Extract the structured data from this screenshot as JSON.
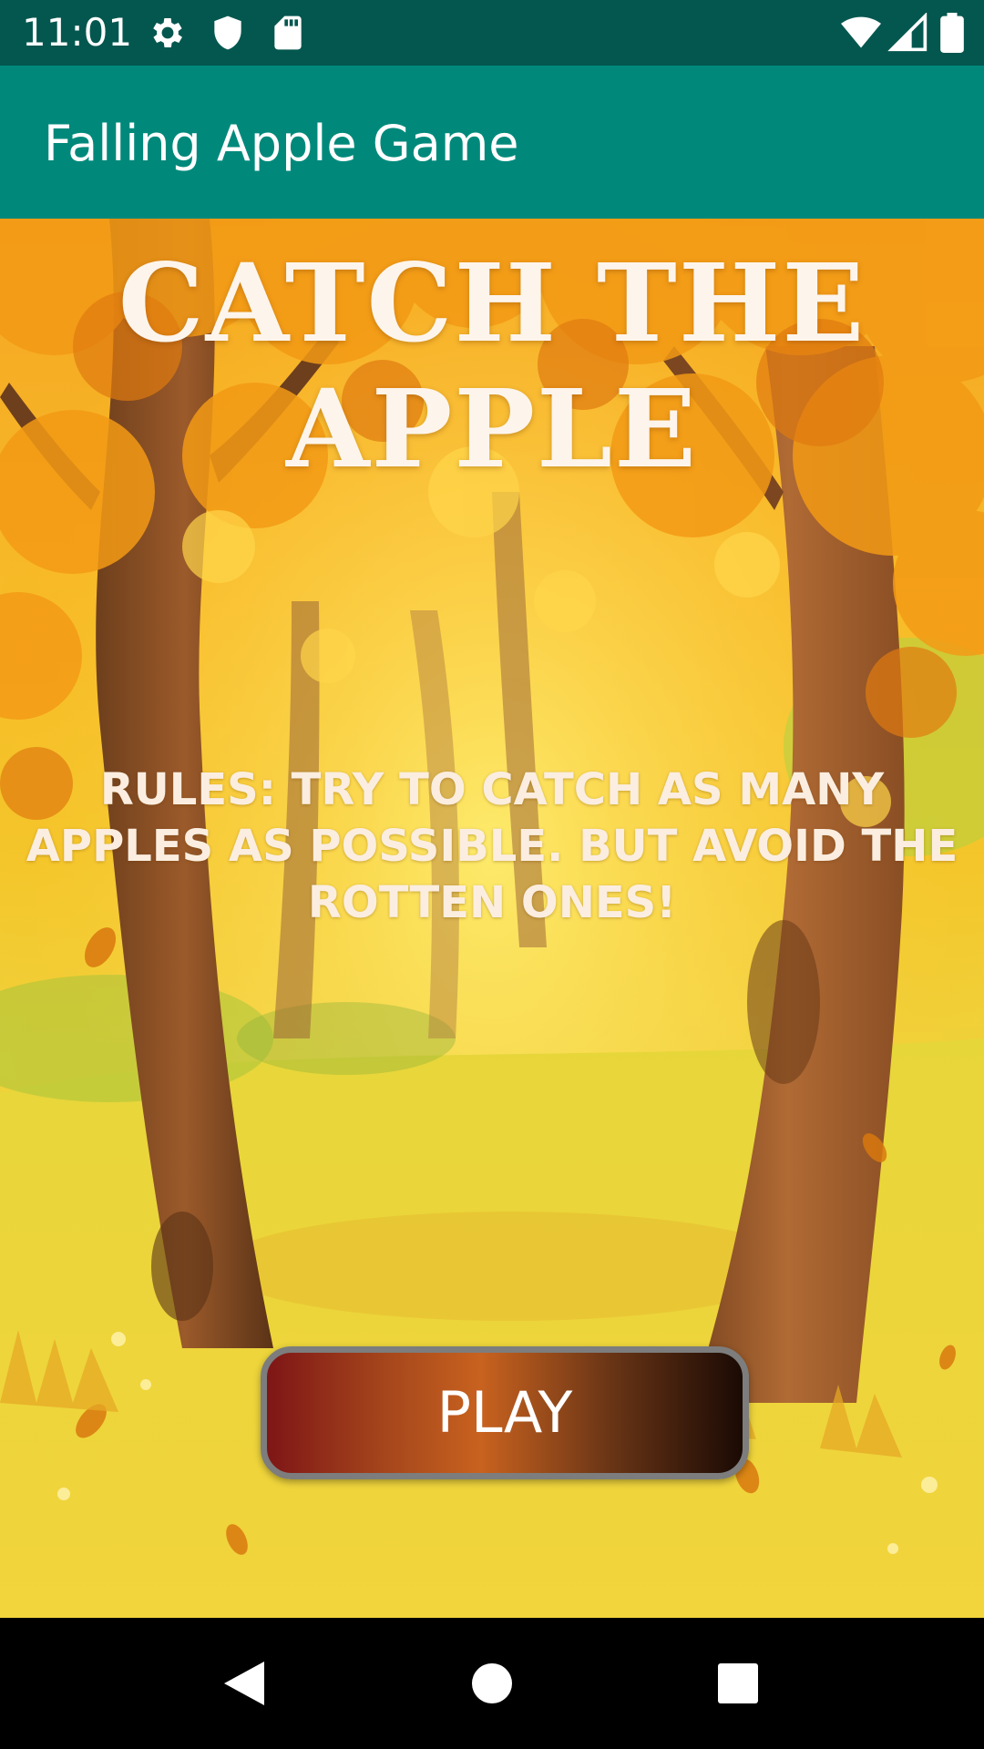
{
  "status_bar": {
    "time": "11:01",
    "icons": [
      "settings-icon",
      "shield-icon",
      "sd-card-icon",
      "wifi-icon",
      "signal-icon",
      "battery-icon"
    ]
  },
  "app_bar": {
    "title": "Falling Apple Game",
    "color": "#00897b"
  },
  "main": {
    "headline": "CATCH THE APPLE",
    "rules": "RULES: TRY TO CATCH AS MANY APPLES AS POSSIBLE. BUT AVOID THE ROTTEN ONES!",
    "play_label": "PLAY",
    "background": "autumn-forest-scene"
  },
  "nav_bar": {
    "buttons": [
      "back-icon",
      "home-icon",
      "recents-icon"
    ]
  }
}
